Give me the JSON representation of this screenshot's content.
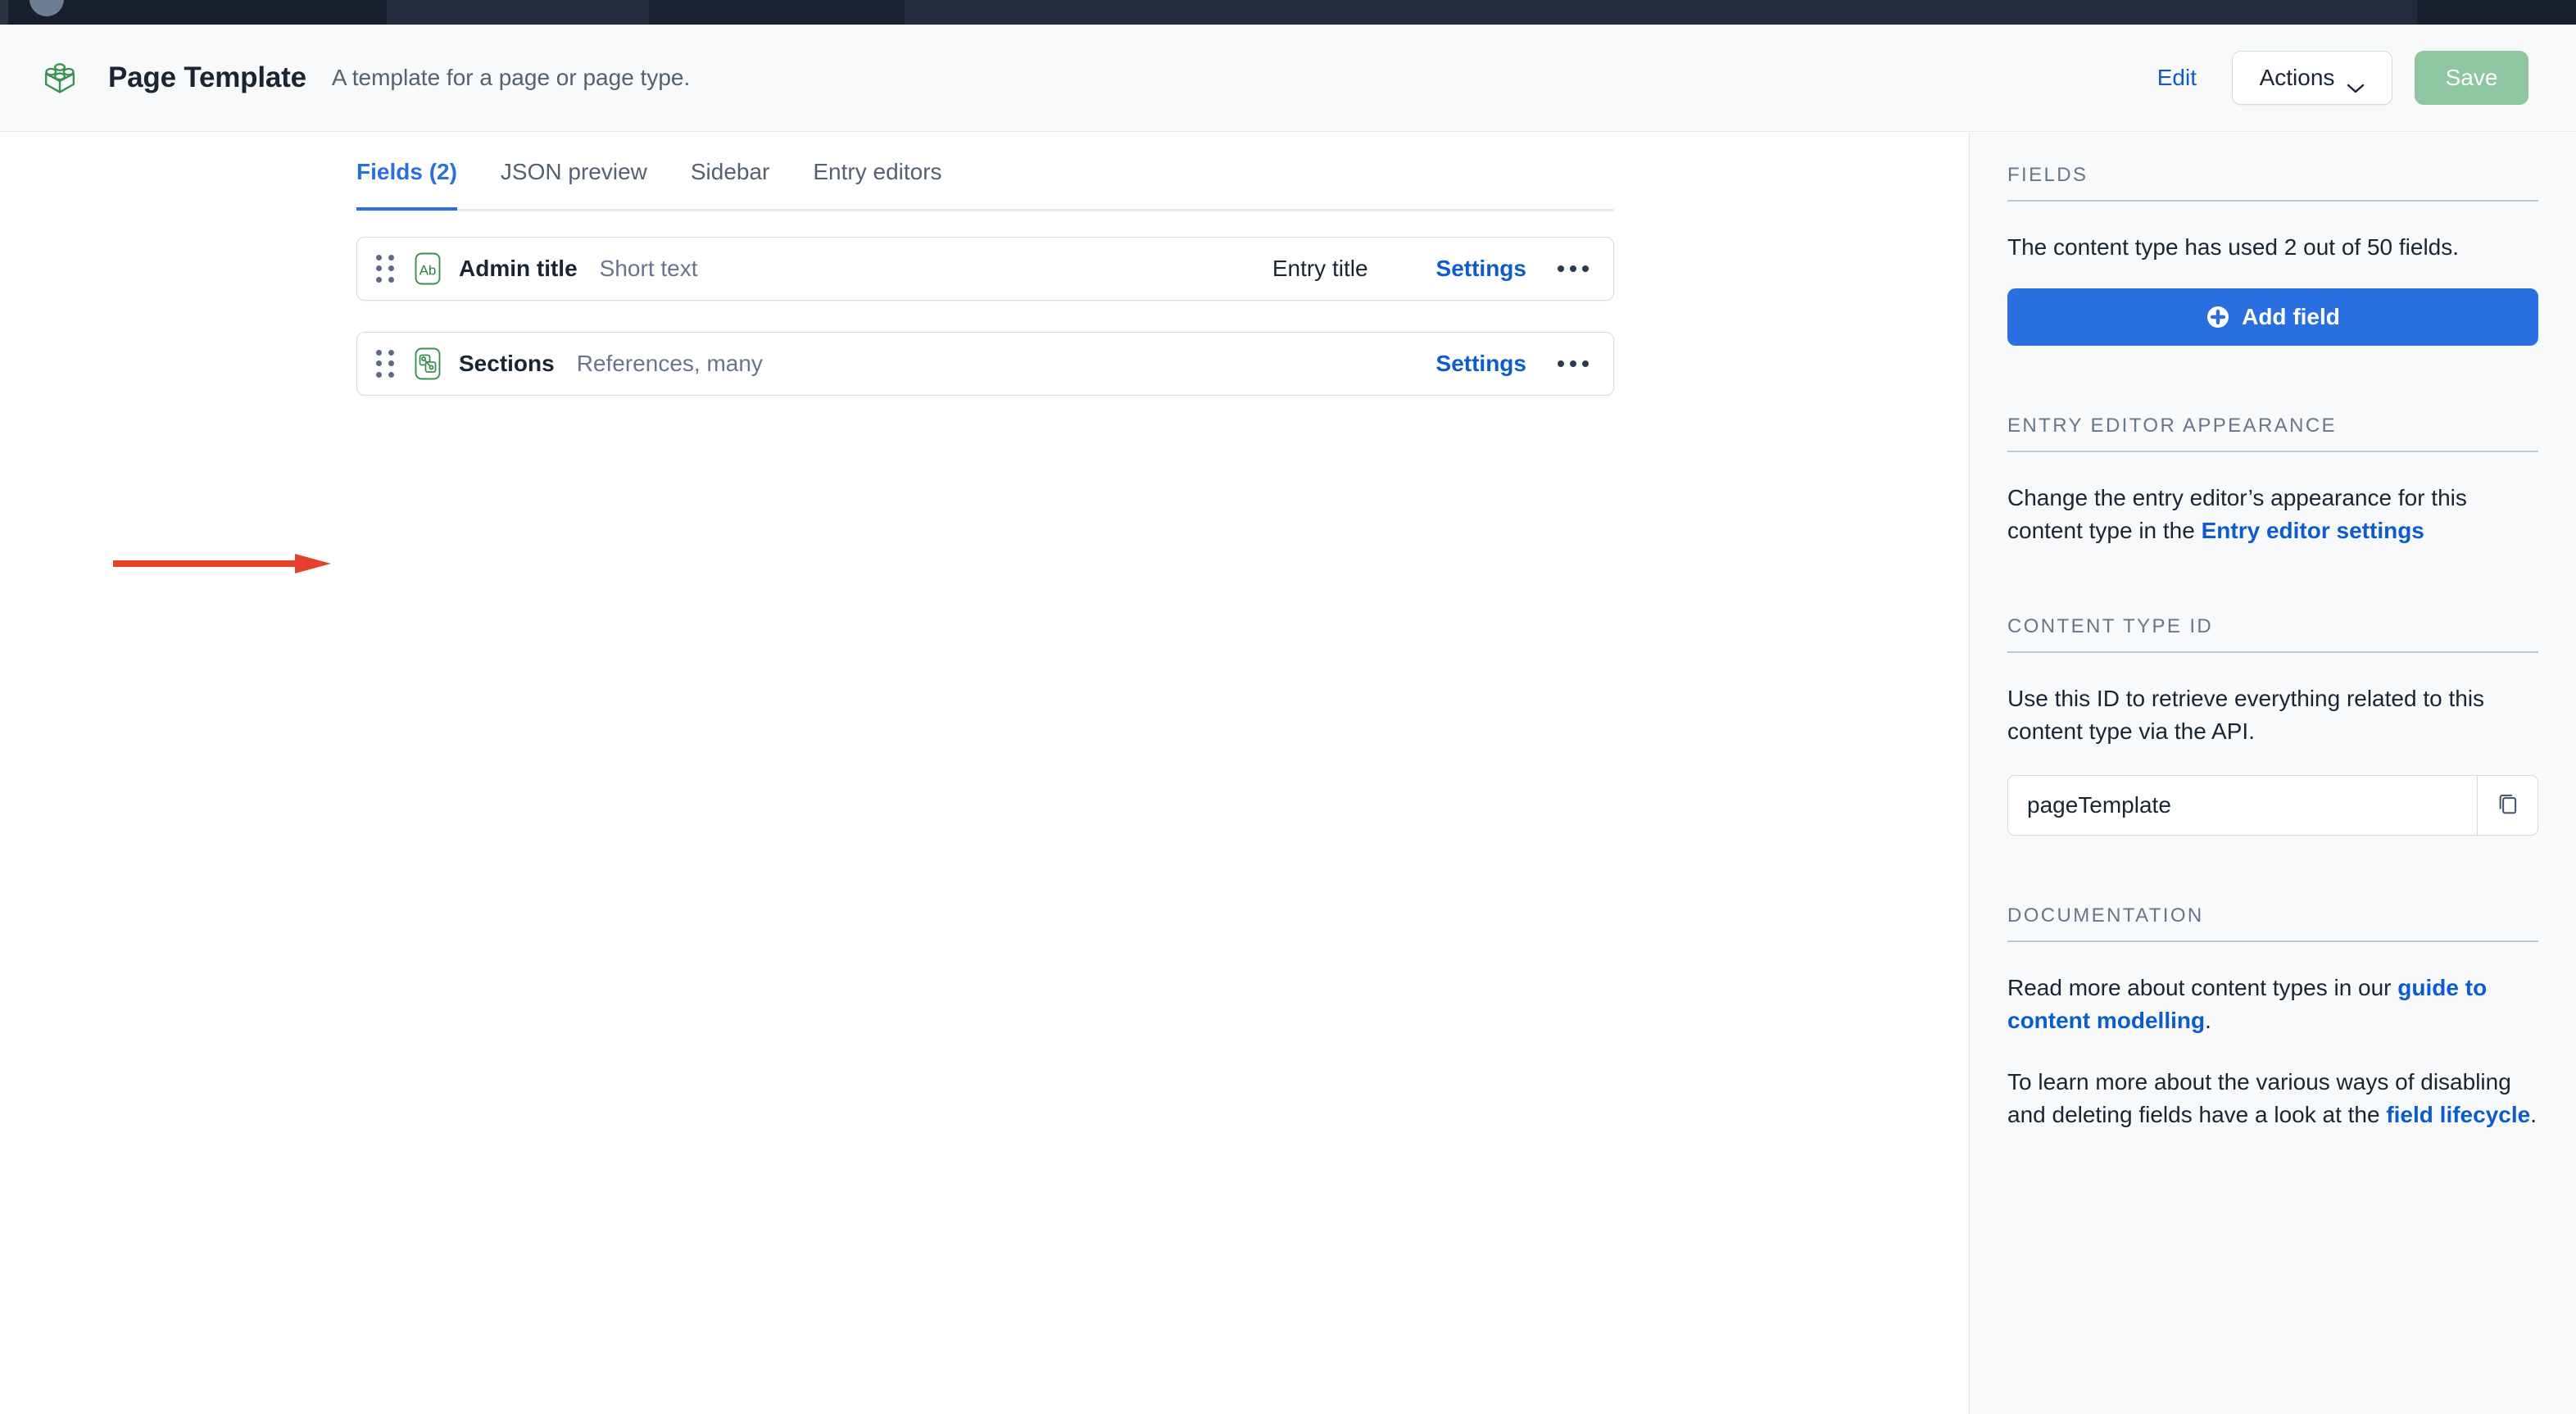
{
  "chrome": {
    "avatar_label": "user-avatar"
  },
  "header": {
    "icon": "content-type-brick-icon",
    "title": "Page Template",
    "description": "A template for a page or page type.",
    "edit_label": "Edit",
    "actions_label": "Actions",
    "save_label": "Save"
  },
  "tabs": [
    {
      "label": "Fields (2)",
      "active": true
    },
    {
      "label": "JSON preview",
      "active": false
    },
    {
      "label": "Sidebar",
      "active": false
    },
    {
      "label": "Entry editors",
      "active": false
    }
  ],
  "fields": [
    {
      "icon": "short-text-ab-icon",
      "name": "Admin title",
      "type": "Short text",
      "badge": "Entry title",
      "settings_label": "Settings",
      "more_label": "more-options"
    },
    {
      "icon": "references-icon",
      "name": "Sections",
      "type": "References, many",
      "badge": "",
      "settings_label": "Settings",
      "more_label": "more-options"
    }
  ],
  "annotation": {
    "arrow_color": "#e8402a",
    "points_to": "Sections field row"
  },
  "sidebar": {
    "fields_section": {
      "title": "FIELDS",
      "description": "The content type has used 2 out of 50 fields.",
      "add_button_label": "Add field"
    },
    "entry_editor_section": {
      "title": "ENTRY EDITOR APPEARANCE",
      "text_before": "Change the entry editor’s appearance for this content type in the ",
      "link_label": "Entry editor settings",
      "text_after": ""
    },
    "content_type_id_section": {
      "title": "CONTENT TYPE ID",
      "description": "Use this ID to retrieve everything related to this content type via the API.",
      "value": "pageTemplate",
      "placeholder": "pageTemplate",
      "copy_icon": "copy-icon"
    },
    "documentation_section": {
      "title": "DOCUMENTATION",
      "p1_before": "Read more about content types in our ",
      "p1_link": "guide to content modelling",
      "p1_after": ".",
      "p2_before": "To learn more about the various ways of disabling and deleting fields have a look at the ",
      "p2_link": "field lifecycle",
      "p2_after": "."
    }
  },
  "colors": {
    "accent_blue": "#2a6fe0",
    "link_blue": "#0d5ccd",
    "save_green": "#8fc5a0",
    "icon_green": "#3c8f52",
    "arrow_red": "#e8402a",
    "chrome_dark": "#1b2433"
  }
}
